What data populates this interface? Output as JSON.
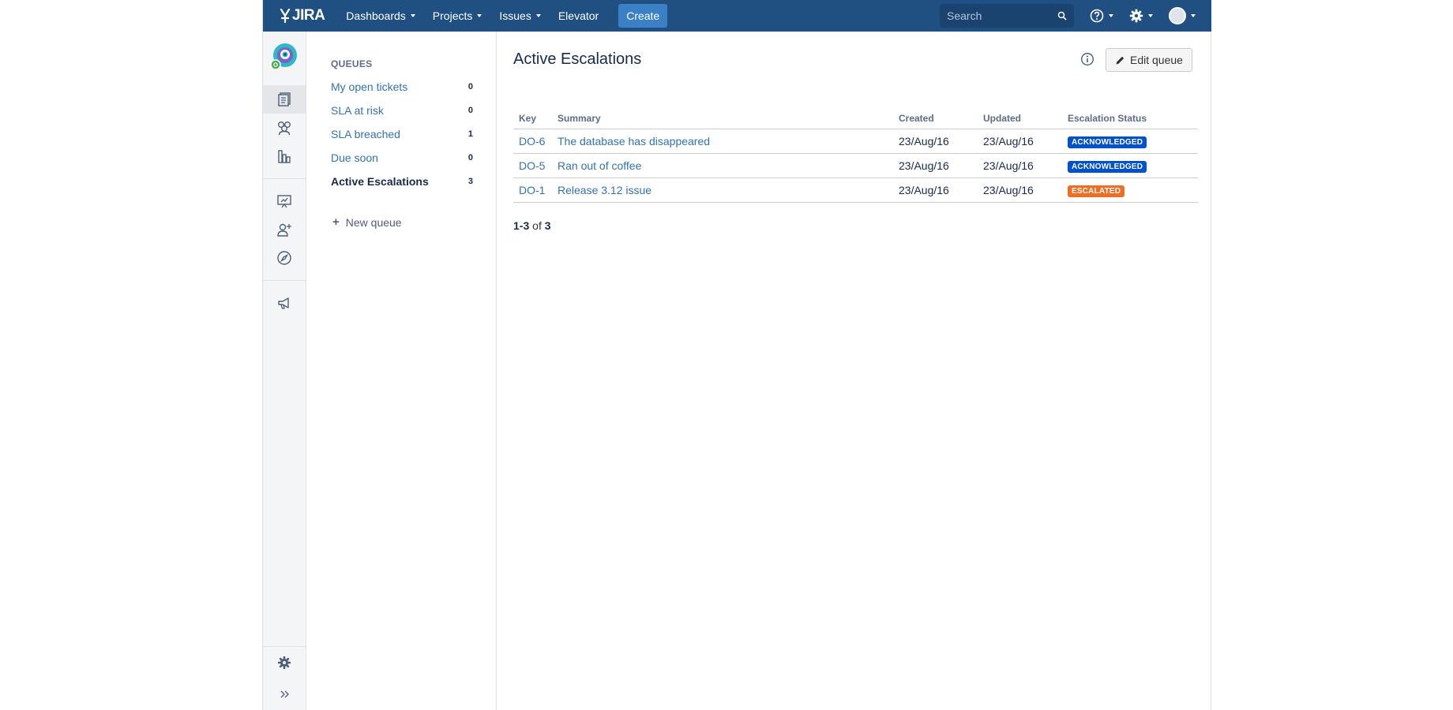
{
  "nav": {
    "logo_text": "JIRA",
    "items": [
      {
        "label": "Dashboards",
        "dropdown": true
      },
      {
        "label": "Projects",
        "dropdown": true
      },
      {
        "label": "Issues",
        "dropdown": true
      },
      {
        "label": "Elevator",
        "dropdown": false
      }
    ],
    "create_label": "Create",
    "search_placeholder": "Search",
    "colors": {
      "bar": "#205081",
      "create": "#3b7fc4"
    }
  },
  "sidebar_icons": [
    "project-avatar",
    "queues-icon",
    "customers-icon",
    "reports-icon",
    "knowledge-base-icon",
    "invite-team-icon",
    "getting-started-icon",
    "announcement-icon",
    "settings-icon",
    "expand-icon"
  ],
  "queues": {
    "heading": "QUEUES",
    "items": [
      {
        "label": "My open tickets",
        "count": "0"
      },
      {
        "label": "SLA at risk",
        "count": "0"
      },
      {
        "label": "SLA breached",
        "count": "1"
      },
      {
        "label": "Due soon",
        "count": "0"
      },
      {
        "label": "Active Escalations",
        "count": "3",
        "active": true
      }
    ],
    "new_queue_label": "New queue"
  },
  "main": {
    "title": "Active Escalations",
    "edit_label": "Edit queue",
    "columns": [
      "Key",
      "Summary",
      "Created",
      "Updated",
      "Escalation Status"
    ],
    "rows": [
      {
        "key": "DO-6",
        "summary": "The database has disappeared",
        "created": "23/Aug/16",
        "updated": "23/Aug/16",
        "status": "ACKNOWLEDGED",
        "status_color": "#0052cc"
      },
      {
        "key": "DO-5",
        "summary": "Ran out of coffee",
        "created": "23/Aug/16",
        "updated": "23/Aug/16",
        "status": "ACKNOWLEDGED",
        "status_color": "#0052cc"
      },
      {
        "key": "DO-1",
        "summary": "Release 3.12 issue",
        "created": "23/Aug/16",
        "updated": "23/Aug/16",
        "status": "ESCALATED",
        "status_color": "#ef6e23"
      }
    ],
    "pager": {
      "start": "1",
      "end": "3",
      "of_label": "of",
      "total": "3"
    }
  }
}
